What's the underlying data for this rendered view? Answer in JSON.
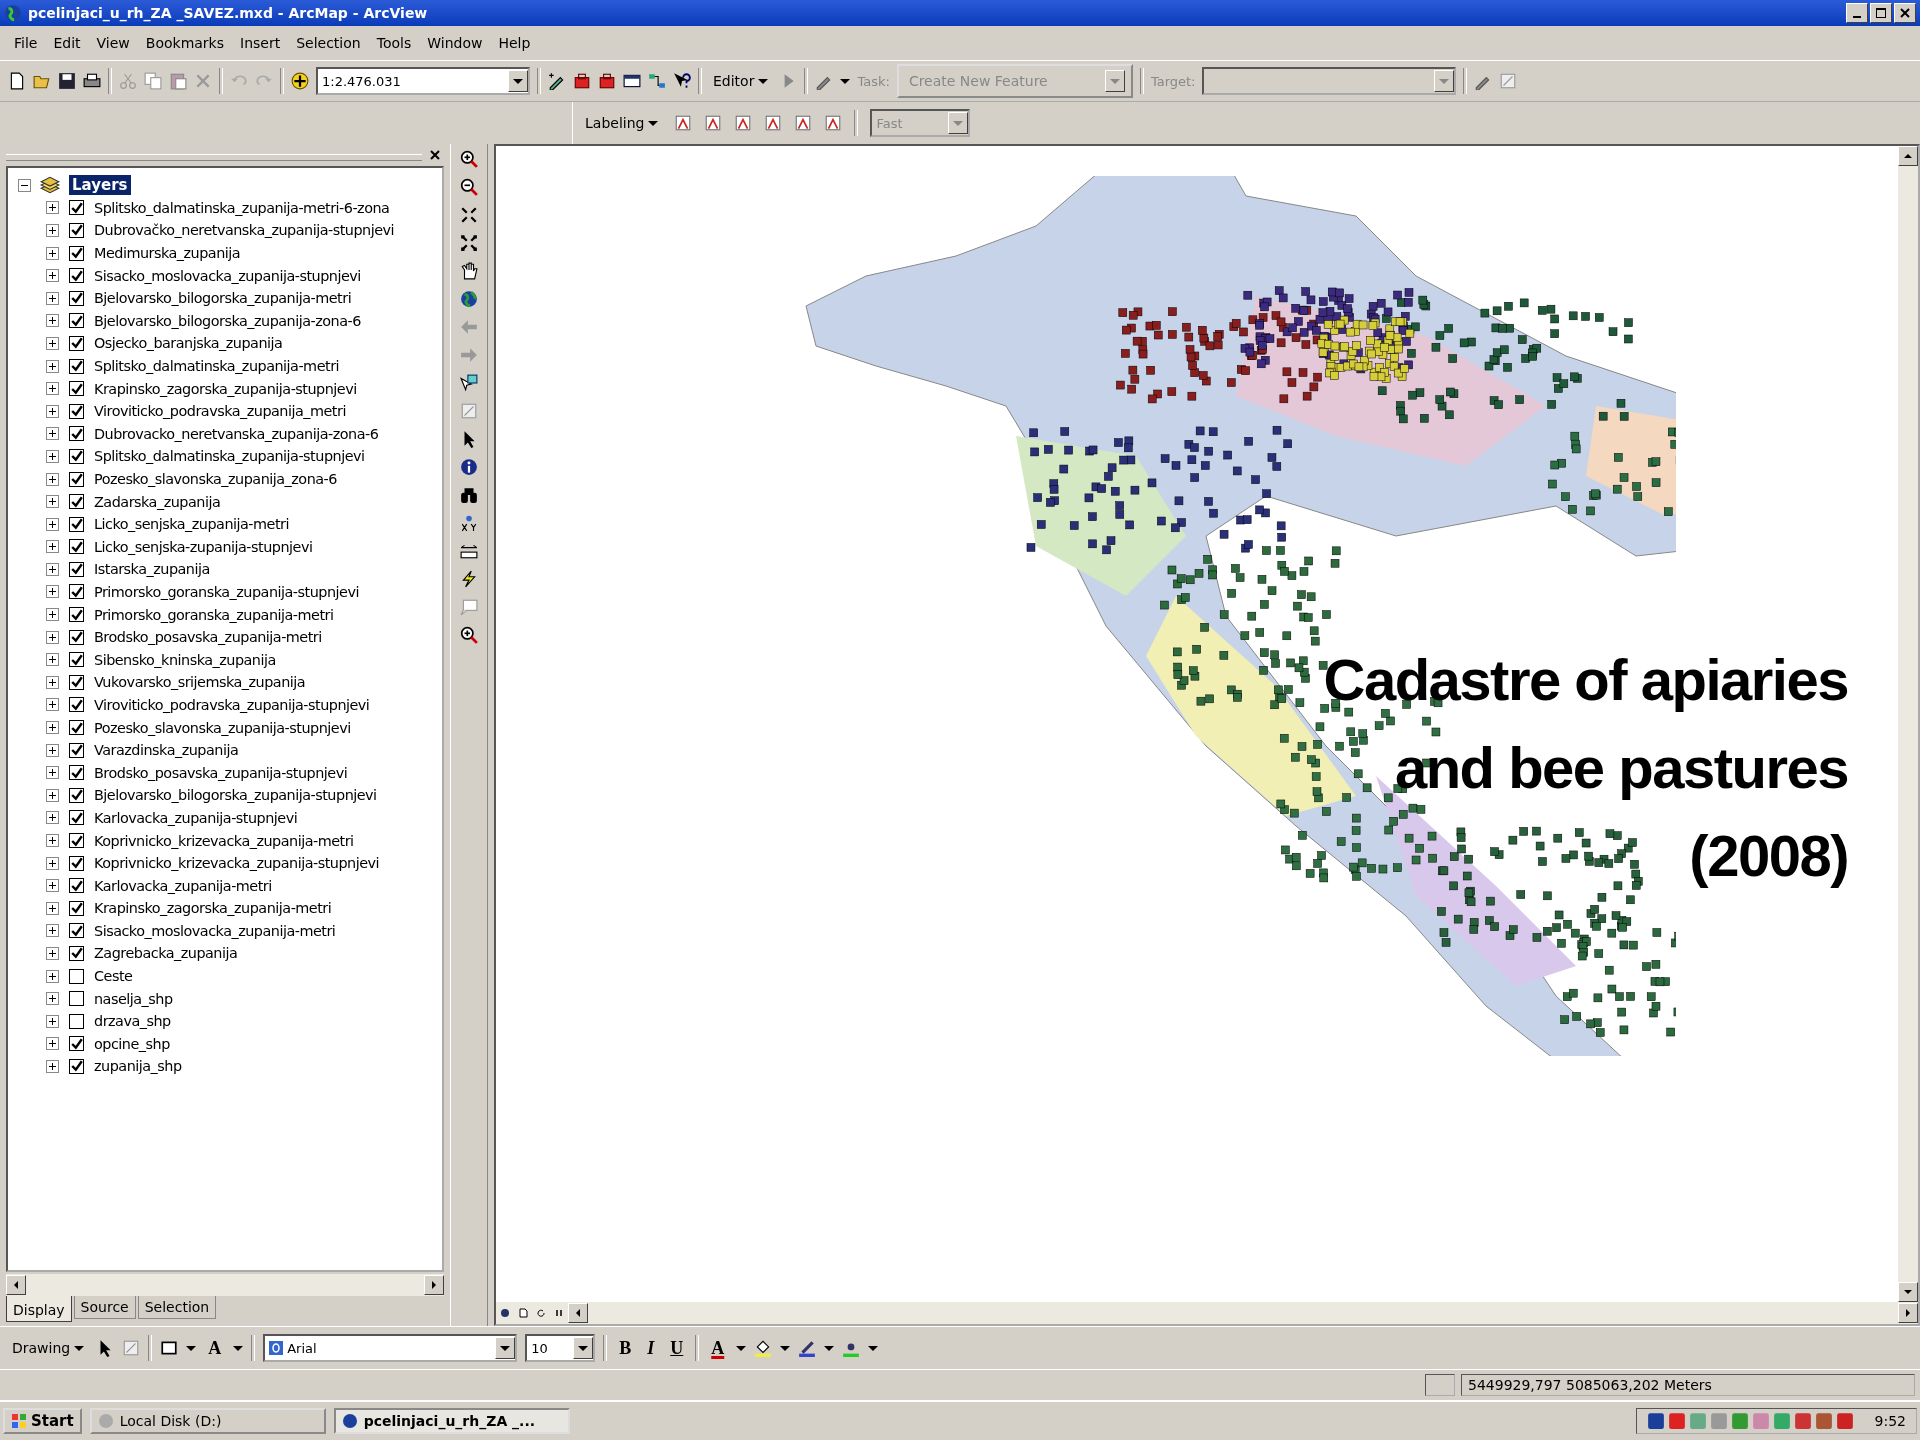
{
  "window": {
    "title": "pcelinjaci_u_rh_ZA _SAVEZ.mxd - ArcMap - ArcView"
  },
  "menu": [
    "File",
    "Edit",
    "View",
    "Bookmarks",
    "Insert",
    "Selection",
    "Tools",
    "Window",
    "Help"
  ],
  "standard_toolbar": {
    "scale": "1:2.476.031",
    "editor": "Editor",
    "task_label": "Task:",
    "task": "Create New Feature",
    "target_label": "Target:"
  },
  "labeling_toolbar": {
    "title": "Labeling",
    "quality": "Fast"
  },
  "toc": {
    "root": "Layers",
    "expanded": true,
    "layers": [
      {
        "name": "Splitsko_dalmatinska_zupanija-metri-6-zona",
        "checked": true
      },
      {
        "name": "Dubrovačko_neretvanska_zupanija-stupnjevi",
        "checked": true
      },
      {
        "name": "Medimurska_zupanija",
        "checked": true
      },
      {
        "name": "Sisacko_moslovacka_zupanija-stupnjevi",
        "checked": true
      },
      {
        "name": "Bjelovarsko_bilogorska_zupanija-metri",
        "checked": true
      },
      {
        "name": "Bjelovarsko_bilogorska_zupanija-zona-6",
        "checked": true
      },
      {
        "name": "Osjecko_baranjska_zupanija",
        "checked": true
      },
      {
        "name": "Splitsko_dalmatinska_zupanija-metri",
        "checked": true
      },
      {
        "name": "Krapinsko_zagorska_zupanija-stupnjevi",
        "checked": true
      },
      {
        "name": "Viroviticko_podravska_zupanija_metri",
        "checked": true
      },
      {
        "name": "Dubrovacko_neretvanska_zupanija-zona-6",
        "checked": true
      },
      {
        "name": "Splitsko_dalmatinska_zupanija-stupnjevi",
        "checked": true
      },
      {
        "name": "Pozesko_slavonska_zupanija_zona-6",
        "checked": true
      },
      {
        "name": "Zadarska_zupanija",
        "checked": true
      },
      {
        "name": "Licko_senjska_zupanija-metri",
        "checked": true
      },
      {
        "name": "Licko_senjska-zupanija-stupnjevi",
        "checked": true
      },
      {
        "name": "Istarska_zupanija",
        "checked": true
      },
      {
        "name": "Primorsko_goranska_zupanija-stupnjevi",
        "checked": true
      },
      {
        "name": "Primorsko_goranska_zupanija-metri",
        "checked": true
      },
      {
        "name": "Brodsko_posavska_zupanija-metri",
        "checked": true
      },
      {
        "name": "Sibensko_kninska_zupanija",
        "checked": true
      },
      {
        "name": "Vukovarsko_srijemska_zupanija",
        "checked": true
      },
      {
        "name": "Viroviticko_podravska_zupanija-stupnjevi",
        "checked": true
      },
      {
        "name": "Pozesko_slavonska_zupanija-stupnjevi",
        "checked": true
      },
      {
        "name": "Varazdinska_zupanija",
        "checked": true
      },
      {
        "name": "Brodsko_posavska_zupanija-stupnjevi",
        "checked": true
      },
      {
        "name": "Bjelovarsko_bilogorska_zupanija-stupnjevi",
        "checked": true
      },
      {
        "name": "Karlovacka_zupanija-stupnjevi",
        "checked": true
      },
      {
        "name": "Koprivnicko_krizevacka_zupanija-metri",
        "checked": true
      },
      {
        "name": "Koprivnicko_krizevacka_zupanija-stupnjevi",
        "checked": true
      },
      {
        "name": "Karlovacka_zupanija-metri",
        "checked": true
      },
      {
        "name": "Krapinsko_zagorska_zupanija-metri",
        "checked": true
      },
      {
        "name": "Sisacko_moslovacka_zupanija-metri",
        "checked": true
      },
      {
        "name": "Zagrebacka_zupanija",
        "checked": true
      },
      {
        "name": "Ceste",
        "checked": false
      },
      {
        "name": "naselja_shp",
        "checked": false
      },
      {
        "name": "drzava_shp",
        "checked": false
      },
      {
        "name": "opcine_shp",
        "checked": true
      },
      {
        "name": "zupanija_shp",
        "checked": true
      }
    ],
    "tabs": [
      {
        "label": "Display",
        "selected": true
      },
      {
        "label": "Source",
        "selected": false
      },
      {
        "label": "Selection",
        "selected": false
      }
    ]
  },
  "map": {
    "overlay_title": "Cadastre of apiaries and bee pastures (2008)"
  },
  "drawing_toolbar": {
    "title": "Drawing",
    "text_tool": "A",
    "font": "Arial",
    "size": "10",
    "bold": "B",
    "italic": "I",
    "underline": "U",
    "font_color": "A"
  },
  "status_bar": {
    "coordinates": "5449929,797  5085063,202 Meters"
  },
  "taskbar": {
    "start": "Start",
    "tasks": [
      {
        "label": "Local Disk (D:)",
        "selected": false
      },
      {
        "label": "pcelinjaci_u_rh_ZA _...",
        "selected": true
      }
    ],
    "clock": "9:52"
  }
}
